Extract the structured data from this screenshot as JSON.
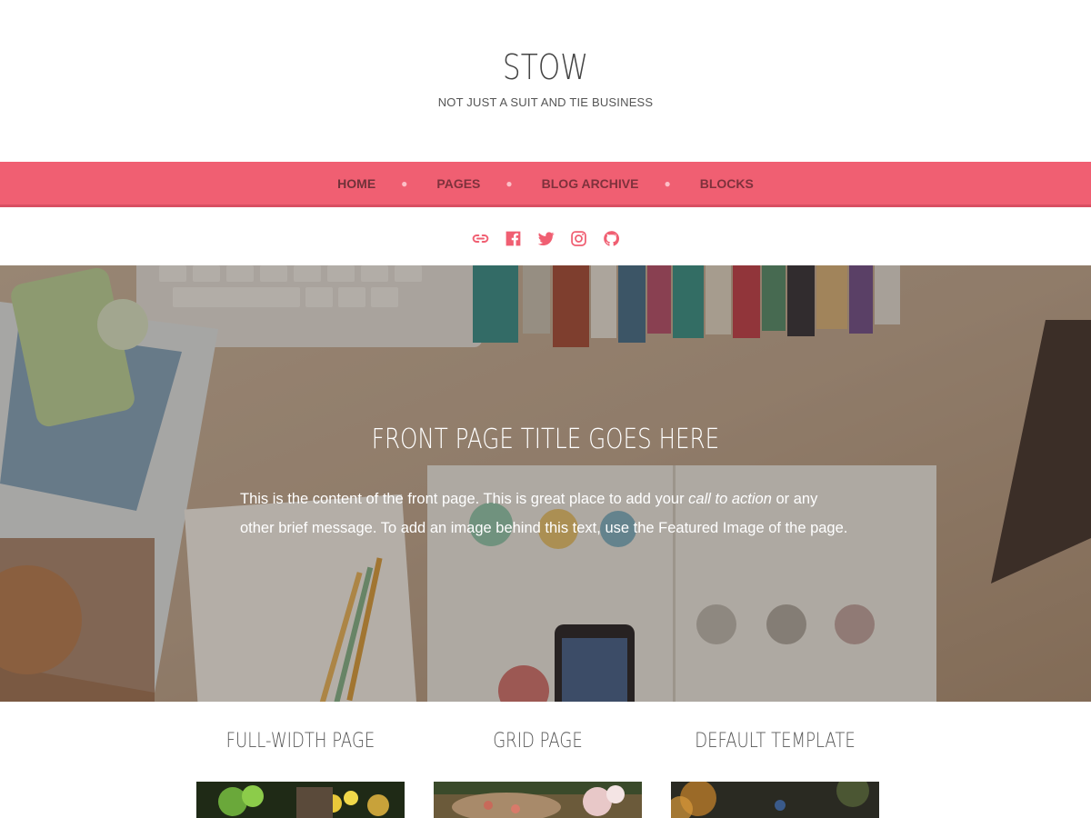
{
  "site": {
    "title": "STOW",
    "tagline": "NOT JUST A SUIT AND TIE BUSINESS"
  },
  "nav": {
    "items": [
      {
        "label": "HOME"
      },
      {
        "label": "PAGES"
      },
      {
        "label": "BLOG ARCHIVE"
      },
      {
        "label": "BLOCKS"
      }
    ]
  },
  "social": {
    "icons": [
      "link-icon",
      "facebook-icon",
      "twitter-icon",
      "instagram-icon",
      "github-icon"
    ]
  },
  "hero": {
    "title": "FRONT PAGE TITLE GOES HERE",
    "text_before": "This is the content of the front page. This is great place to add your ",
    "text_em": "call to action",
    "text_after": " or any other brief message. To add an image behind this text, use the Featured Image of the page."
  },
  "grid": {
    "items": [
      {
        "title": "FULL-WIDTH PAGE"
      },
      {
        "title": "GRID PAGE"
      },
      {
        "title": "DEFAULT TEMPLATE"
      }
    ]
  },
  "colors": {
    "accent": "#f05f72"
  }
}
